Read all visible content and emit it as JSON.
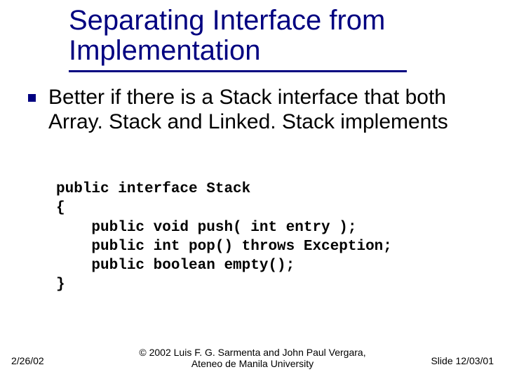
{
  "title": "Separating Interface from Implementation",
  "bullet": "Better if there is a Stack interface that both Array. Stack and Linked. Stack implements",
  "code": "public interface Stack\n{\n    public void push( int entry );\n    public int pop() throws Exception;\n    public boolean empty();\n}",
  "footer": {
    "date": "2/26/02",
    "copyright_line1": "© 2002 Luis F. G. Sarmenta and John Paul Vergara,",
    "copyright_line2": "Ateneo de Manila University",
    "slide": "Slide 12/03/01"
  }
}
